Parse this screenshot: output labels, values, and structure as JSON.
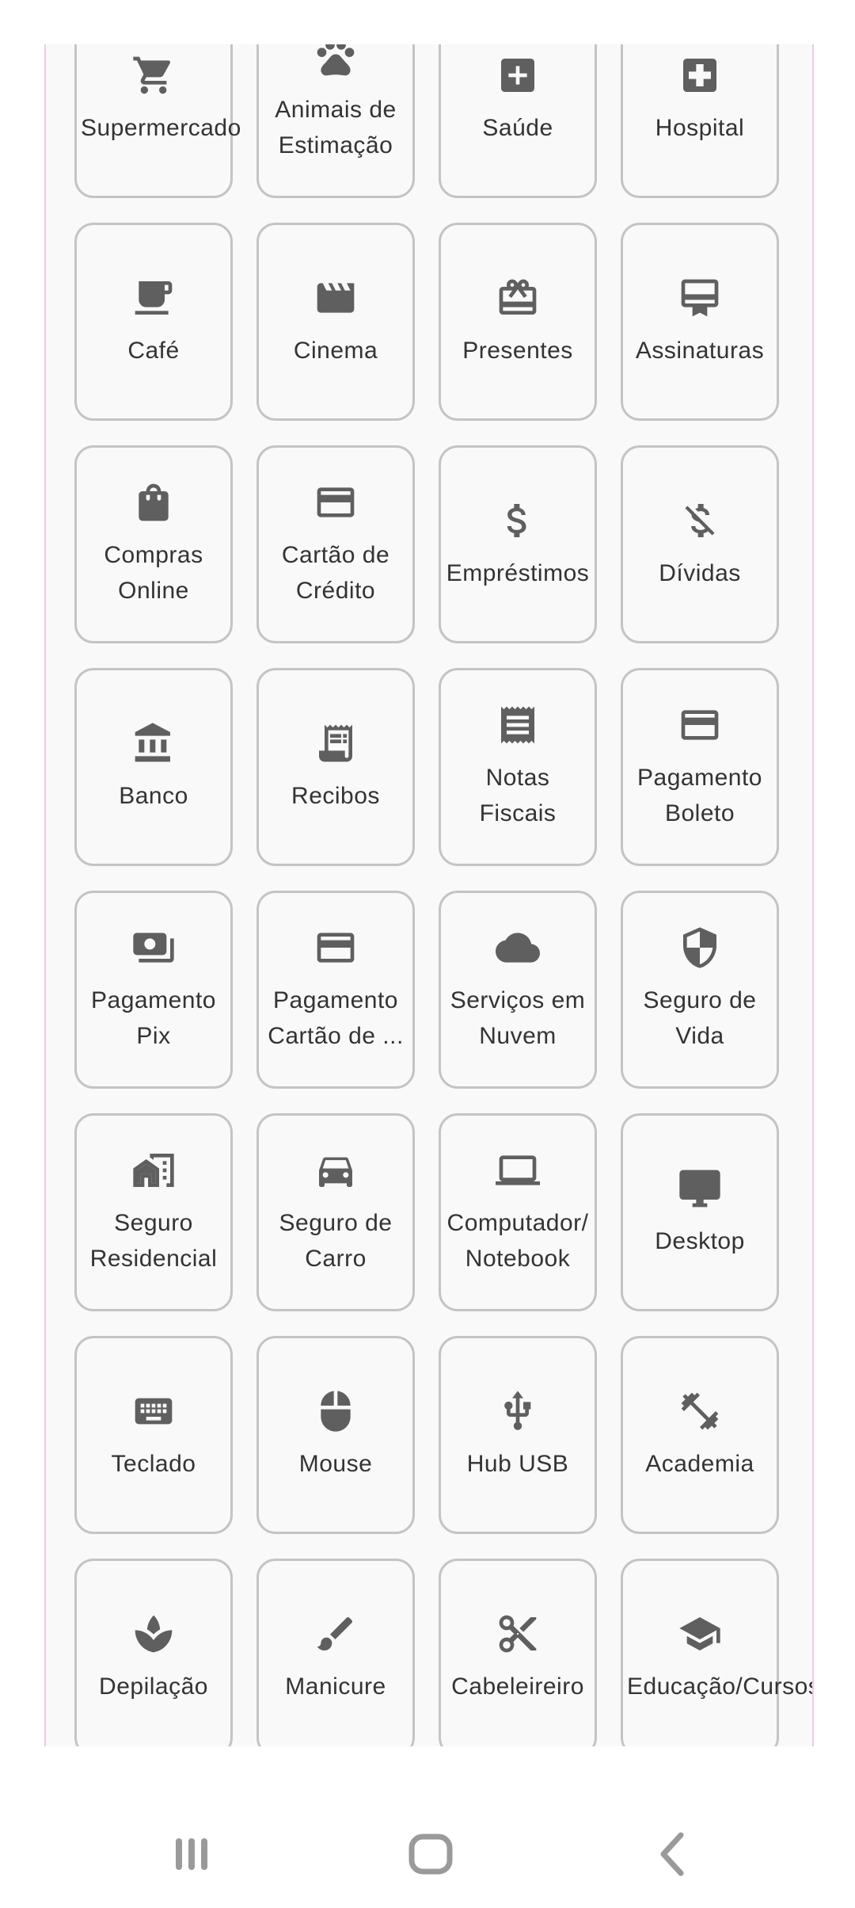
{
  "categories": [
    {
      "label": "Supermercado",
      "icon": "cart-icon"
    },
    {
      "label": "Animais de Estimação",
      "icon": "pet-icon"
    },
    {
      "label": "Saúde",
      "icon": "health-icon"
    },
    {
      "label": "Hospital",
      "icon": "hospital-icon"
    },
    {
      "label": "Café",
      "icon": "coffee-icon"
    },
    {
      "label": "Cinema",
      "icon": "movie-icon"
    },
    {
      "label": "Presentes",
      "icon": "gift-icon"
    },
    {
      "label": "Assinaturas",
      "icon": "subscription-icon"
    },
    {
      "label": "Compras Online",
      "icon": "shopping-bag-icon"
    },
    {
      "label": "Cartão de Crédito",
      "icon": "credit-card-icon"
    },
    {
      "label": "Empréstimos",
      "icon": "dollar-icon"
    },
    {
      "label": "Dívidas",
      "icon": "money-off-icon"
    },
    {
      "label": "Banco",
      "icon": "bank-icon"
    },
    {
      "label": "Recibos",
      "icon": "receipt-icon"
    },
    {
      "label": "Notas Fiscais",
      "icon": "invoice-icon"
    },
    {
      "label": "Pagamento Boleto",
      "icon": "payment-card-icon"
    },
    {
      "label": "Pagamento Pix",
      "icon": "cash-icon"
    },
    {
      "label": "Pagamento Cartão de ...",
      "icon": "credit-card-icon"
    },
    {
      "label": "Serviços em Nuvem",
      "icon": "cloud-icon"
    },
    {
      "label": "Seguro de Vida",
      "icon": "shield-icon"
    },
    {
      "label": "Seguro Residencial",
      "icon": "house-icon"
    },
    {
      "label": "Seguro de Carro",
      "icon": "car-icon"
    },
    {
      "label": "Computador/Notebook",
      "icon": "laptop-icon"
    },
    {
      "label": "Desktop",
      "icon": "desktop-icon"
    },
    {
      "label": "Teclado",
      "icon": "keyboard-icon"
    },
    {
      "label": "Mouse",
      "icon": "mouse-icon"
    },
    {
      "label": "Hub USB",
      "icon": "usb-icon"
    },
    {
      "label": "Academia",
      "icon": "dumbbell-icon"
    },
    {
      "label": "Depilação",
      "icon": "spa-icon"
    },
    {
      "label": "Manicure",
      "icon": "brush-icon"
    },
    {
      "label": "Cabeleireiro",
      "icon": "scissors-icon"
    },
    {
      "label": "Educação/Cursos",
      "icon": "graduation-cap-icon"
    }
  ],
  "navigation": {
    "recents": "recent-apps-icon",
    "home": "home-icon",
    "back": "back-icon"
  },
  "colors": {
    "icon": "#5f5f5f",
    "tile_border": "#c4c4c4",
    "panel_background": "#f9f9f9",
    "panel_edge": "#f0c8e8"
  }
}
